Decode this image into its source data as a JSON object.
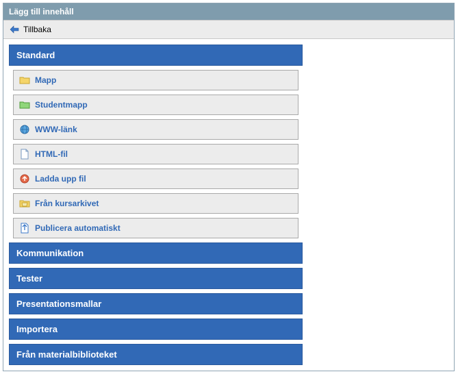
{
  "header": {
    "title": "Lägg till innehåll"
  },
  "back": {
    "label": "Tillbaka"
  },
  "sections": [
    {
      "title": "Standard",
      "expanded": true,
      "items": [
        {
          "label": "Mapp",
          "icon": "folder-icon"
        },
        {
          "label": "Studentmapp",
          "icon": "student-folder-icon"
        },
        {
          "label": "WWW-länk",
          "icon": "globe-icon"
        },
        {
          "label": "HTML-fil",
          "icon": "html-file-icon"
        },
        {
          "label": "Ladda upp fil",
          "icon": "upload-file-icon"
        },
        {
          "label": "Från kursarkivet",
          "icon": "archive-folder-icon"
        },
        {
          "label": "Publicera automatiskt",
          "icon": "publish-auto-icon"
        }
      ]
    },
    {
      "title": "Kommunikation",
      "expanded": false,
      "items": []
    },
    {
      "title": "Tester",
      "expanded": false,
      "items": []
    },
    {
      "title": "Presentationsmallar",
      "expanded": false,
      "items": []
    },
    {
      "title": "Importera",
      "expanded": false,
      "items": []
    },
    {
      "title": "Från materialbiblioteket",
      "expanded": false,
      "items": []
    }
  ]
}
